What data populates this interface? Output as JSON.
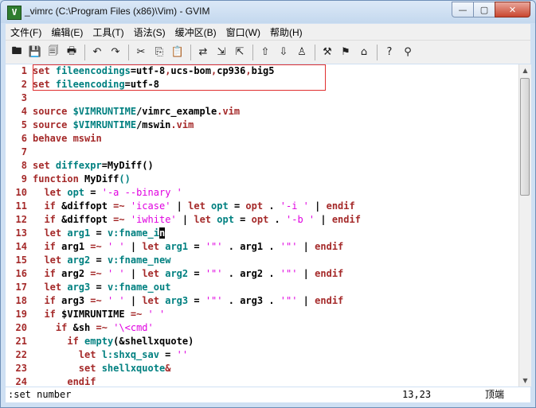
{
  "window": {
    "title": "_vimrc (C:\\Program Files (x86)\\Vim) - GVIM",
    "app_icon_letter": "V",
    "minimize_glyph": "—",
    "maximize_glyph": "▢",
    "close_glyph": "✕"
  },
  "menu": [
    "文件(F)",
    "编辑(E)",
    "工具(T)",
    "语法(S)",
    "缓冲区(B)",
    "窗口(W)",
    "帮助(H)"
  ],
  "toolbar": {
    "groups": [
      [
        {
          "name": "open-icon",
          "glyph": "🖿"
        },
        {
          "name": "save-icon",
          "glyph": "💾"
        },
        {
          "name": "save-all-icon",
          "glyph": "🗐"
        },
        {
          "name": "print-icon",
          "glyph": "🖶"
        }
      ],
      [
        {
          "name": "undo-icon",
          "glyph": "↶"
        },
        {
          "name": "redo-icon",
          "glyph": "↷"
        }
      ],
      [
        {
          "name": "cut-icon",
          "glyph": "✂"
        },
        {
          "name": "copy-icon",
          "glyph": "⎘"
        },
        {
          "name": "paste-icon",
          "glyph": "📋"
        }
      ],
      [
        {
          "name": "replace-icon",
          "glyph": "⇄"
        },
        {
          "name": "find-next-icon",
          "glyph": "⇲"
        },
        {
          "name": "find-prev-icon",
          "glyph": "⇱"
        }
      ],
      [
        {
          "name": "load-session-icon",
          "glyph": "⇧"
        },
        {
          "name": "save-session-icon",
          "glyph": "⇩"
        },
        {
          "name": "run-script-icon",
          "glyph": "♙"
        }
      ],
      [
        {
          "name": "make-icon",
          "glyph": "⚒"
        },
        {
          "name": "build-tags-icon",
          "glyph": "⚑"
        },
        {
          "name": "jump-tag-icon",
          "glyph": "⌂"
        }
      ],
      [
        {
          "name": "help-icon",
          "glyph": "?"
        },
        {
          "name": "find-help-icon",
          "glyph": "⚲"
        }
      ]
    ]
  },
  "editor": {
    "lines": [
      {
        "n": "1",
        "t": [
          [
            "kw",
            "set "
          ],
          [
            "var",
            "fileencodings"
          ],
          [
            "plain",
            "=utf-8"
          ],
          [
            "kw",
            ","
          ],
          [
            "plain",
            "ucs-bom"
          ],
          [
            "kw",
            ","
          ],
          [
            "plain",
            "cp936"
          ],
          [
            "kw",
            ","
          ],
          [
            "plain",
            "big5"
          ]
        ]
      },
      {
        "n": "2",
        "t": [
          [
            "kw",
            "set "
          ],
          [
            "var",
            "fileencoding"
          ],
          [
            "plain",
            "=utf-8"
          ]
        ]
      },
      {
        "n": "3",
        "t": []
      },
      {
        "n": "4",
        "t": [
          [
            "kw",
            "source "
          ],
          [
            "var",
            "$VIMRUNTIME"
          ],
          [
            "plain",
            "/vimrc_example"
          ],
          [
            "kw",
            "."
          ],
          [
            "kw",
            "vim"
          ]
        ]
      },
      {
        "n": "5",
        "t": [
          [
            "kw",
            "source "
          ],
          [
            "var",
            "$VIMRUNTIME"
          ],
          [
            "plain",
            "/mswin"
          ],
          [
            "kw",
            "."
          ],
          [
            "kw",
            "vim"
          ]
        ]
      },
      {
        "n": "6",
        "t": [
          [
            "kw",
            "behave mswin"
          ]
        ]
      },
      {
        "n": "7",
        "t": []
      },
      {
        "n": "8",
        "t": [
          [
            "kw",
            "set "
          ],
          [
            "var",
            "diffexpr"
          ],
          [
            "plain",
            "=MyDiff()"
          ]
        ]
      },
      {
        "n": "9",
        "t": [
          [
            "kw",
            "function "
          ],
          [
            "plain",
            "MyDiff"
          ],
          [
            "var",
            "()"
          ]
        ]
      },
      {
        "n": "10",
        "t": [
          [
            "plain",
            "  "
          ],
          [
            "kw",
            "let "
          ],
          [
            "var",
            "opt"
          ],
          [
            "plain",
            " = "
          ],
          [
            "str",
            "'-a --binary '"
          ]
        ]
      },
      {
        "n": "11",
        "t": [
          [
            "plain",
            "  "
          ],
          [
            "kw",
            "if "
          ],
          [
            "plain",
            "&diffopt "
          ],
          [
            "kw",
            "=~ "
          ],
          [
            "str",
            "'icase'"
          ],
          [
            "plain",
            " | "
          ],
          [
            "kw",
            "let "
          ],
          [
            "var",
            "opt"
          ],
          [
            "plain",
            " = "
          ],
          [
            "kw",
            "opt"
          ],
          [
            "plain",
            " . "
          ],
          [
            "str",
            "'-i '"
          ],
          [
            "plain",
            " | "
          ],
          [
            "kw",
            "endif"
          ]
        ]
      },
      {
        "n": "12",
        "t": [
          [
            "plain",
            "  "
          ],
          [
            "kw",
            "if "
          ],
          [
            "plain",
            "&diffopt "
          ],
          [
            "kw",
            "=~ "
          ],
          [
            "str",
            "'iwhite'"
          ],
          [
            "plain",
            " | "
          ],
          [
            "kw",
            "let "
          ],
          [
            "var",
            "opt"
          ],
          [
            "plain",
            " = "
          ],
          [
            "kw",
            "opt"
          ],
          [
            "plain",
            " . "
          ],
          [
            "str",
            "'-b '"
          ],
          [
            "plain",
            " | "
          ],
          [
            "kw",
            "endif"
          ]
        ]
      },
      {
        "n": "13",
        "t": [
          [
            "plain",
            "  "
          ],
          [
            "kw",
            "let "
          ],
          [
            "var",
            "arg1"
          ],
          [
            "plain",
            " = "
          ],
          [
            "var",
            "v:fname_i"
          ],
          [
            "cursor",
            "n"
          ]
        ]
      },
      {
        "n": "14",
        "t": [
          [
            "plain",
            "  "
          ],
          [
            "kw",
            "if "
          ],
          [
            "plain",
            "arg1 "
          ],
          [
            "kw",
            "=~ "
          ],
          [
            "str",
            "' '"
          ],
          [
            "plain",
            " | "
          ],
          [
            "kw",
            "let "
          ],
          [
            "var",
            "arg1"
          ],
          [
            "plain",
            " = "
          ],
          [
            "str",
            "'\"'"
          ],
          [
            "plain",
            " . arg1 . "
          ],
          [
            "str",
            "'\"'"
          ],
          [
            "plain",
            " | "
          ],
          [
            "kw",
            "endif"
          ]
        ]
      },
      {
        "n": "15",
        "t": [
          [
            "plain",
            "  "
          ],
          [
            "kw",
            "let "
          ],
          [
            "var",
            "arg2"
          ],
          [
            "plain",
            " = "
          ],
          [
            "var",
            "v:fname_new"
          ]
        ]
      },
      {
        "n": "16",
        "t": [
          [
            "plain",
            "  "
          ],
          [
            "kw",
            "if "
          ],
          [
            "plain",
            "arg2 "
          ],
          [
            "kw",
            "=~ "
          ],
          [
            "str",
            "' '"
          ],
          [
            "plain",
            " | "
          ],
          [
            "kw",
            "let "
          ],
          [
            "var",
            "arg2"
          ],
          [
            "plain",
            " = "
          ],
          [
            "str",
            "'\"'"
          ],
          [
            "plain",
            " . arg2 . "
          ],
          [
            "str",
            "'\"'"
          ],
          [
            "plain",
            " | "
          ],
          [
            "kw",
            "endif"
          ]
        ]
      },
      {
        "n": "17",
        "t": [
          [
            "plain",
            "  "
          ],
          [
            "kw",
            "let "
          ],
          [
            "var",
            "arg3"
          ],
          [
            "plain",
            " = "
          ],
          [
            "var",
            "v:fname_out"
          ]
        ]
      },
      {
        "n": "18",
        "t": [
          [
            "plain",
            "  "
          ],
          [
            "kw",
            "if "
          ],
          [
            "plain",
            "arg3 "
          ],
          [
            "kw",
            "=~ "
          ],
          [
            "str",
            "' '"
          ],
          [
            "plain",
            " | "
          ],
          [
            "kw",
            "let "
          ],
          [
            "var",
            "arg3"
          ],
          [
            "plain",
            " = "
          ],
          [
            "str",
            "'\"'"
          ],
          [
            "plain",
            " . arg3 . "
          ],
          [
            "str",
            "'\"'"
          ],
          [
            "plain",
            " | "
          ],
          [
            "kw",
            "endif"
          ]
        ]
      },
      {
        "n": "19",
        "t": [
          [
            "plain",
            "  "
          ],
          [
            "kw",
            "if "
          ],
          [
            "plain",
            "$VIMRUNTIME "
          ],
          [
            "kw",
            "=~ "
          ],
          [
            "str",
            "' '"
          ]
        ]
      },
      {
        "n": "20",
        "t": [
          [
            "plain",
            "    "
          ],
          [
            "kw",
            "if "
          ],
          [
            "plain",
            "&sh "
          ],
          [
            "kw",
            "=~ "
          ],
          [
            "str",
            "'\\<cmd'"
          ]
        ]
      },
      {
        "n": "21",
        "t": [
          [
            "plain",
            "      "
          ],
          [
            "kw",
            "if "
          ],
          [
            "var",
            "empty"
          ],
          [
            "plain",
            "(&shellxquote)"
          ]
        ]
      },
      {
        "n": "22",
        "t": [
          [
            "plain",
            "        "
          ],
          [
            "kw",
            "let "
          ],
          [
            "var",
            "l:shxq_sav"
          ],
          [
            "plain",
            " = "
          ],
          [
            "str",
            "''"
          ]
        ]
      },
      {
        "n": "23",
        "t": [
          [
            "plain",
            "        "
          ],
          [
            "kw",
            "set "
          ],
          [
            "var",
            "shellxquote"
          ],
          [
            "kw",
            "&"
          ]
        ]
      },
      {
        "n": "24",
        "t": [
          [
            "plain",
            "      "
          ],
          [
            "kw",
            "endif"
          ]
        ]
      }
    ]
  },
  "cmdline": {
    "command": ":set number",
    "position": "13,23",
    "scroll": "顶端"
  }
}
